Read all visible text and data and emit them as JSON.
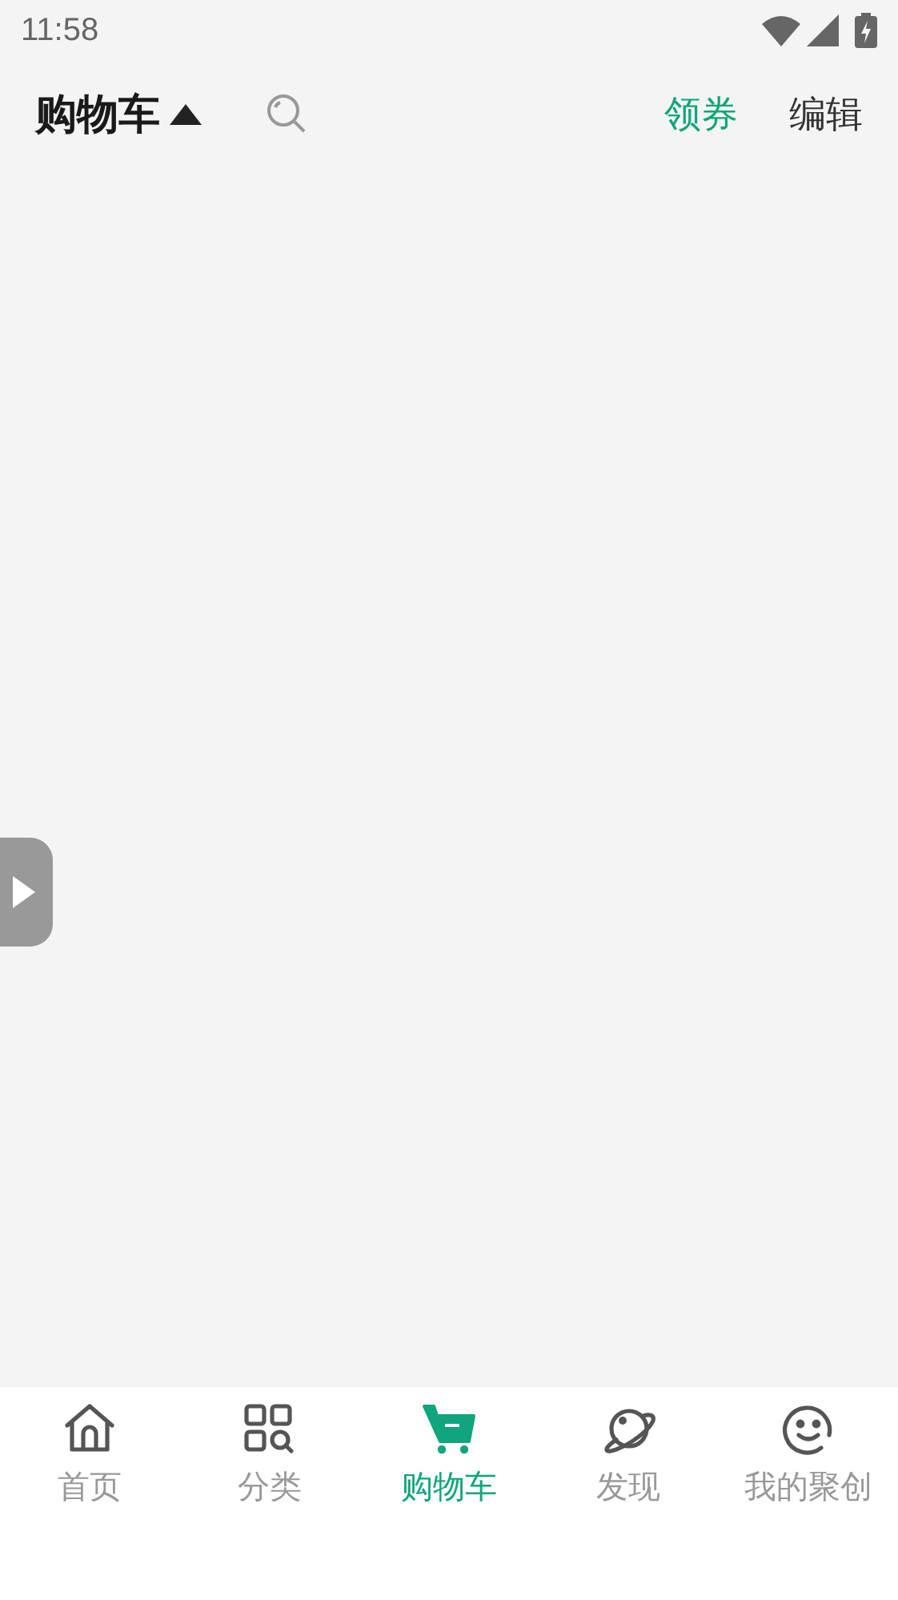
{
  "status_bar": {
    "time": "11:58"
  },
  "header": {
    "title": "购物车",
    "actions": [
      {
        "label": "领券",
        "kind": "accent"
      },
      {
        "label": "编辑",
        "kind": "plain"
      }
    ]
  },
  "tabs": [
    {
      "label": "首页",
      "selected": false
    },
    {
      "label": "分类",
      "selected": false
    },
    {
      "label": "购物车",
      "selected": true
    },
    {
      "label": "发现",
      "selected": false
    },
    {
      "label": "我的聚创",
      "selected": false
    }
  ]
}
